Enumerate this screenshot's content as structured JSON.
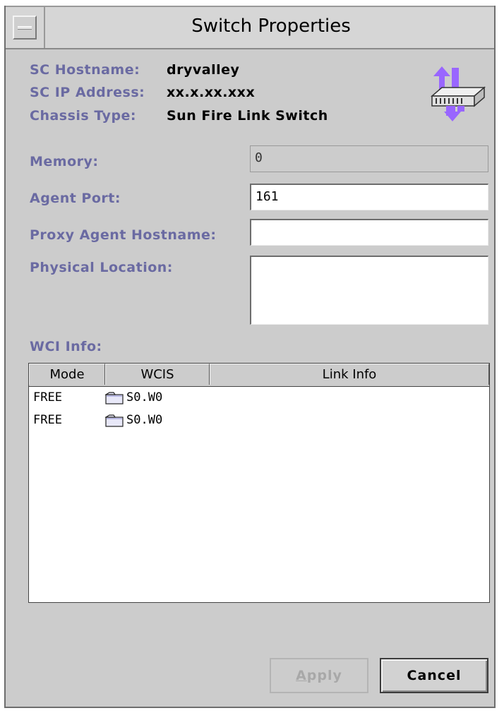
{
  "window": {
    "title": "Switch Properties"
  },
  "header": {
    "hostname_label": "SC Hostname:",
    "hostname_value": "dryvalley",
    "ip_label": "SC IP Address:",
    "ip_value": "xx.x.xx.xxx",
    "chassis_label": "Chassis Type:",
    "chassis_value": "Sun Fire Link Switch",
    "icon": "network-switch-icon"
  },
  "form": {
    "memory_label": "Memory:",
    "memory_value": "0",
    "agent_port_label": "Agent Port:",
    "agent_port_value": "161",
    "proxy_label": "Proxy Agent Hostname:",
    "proxy_value": "",
    "location_label": "Physical Location:",
    "location_value": ""
  },
  "wci": {
    "label": "WCI Info:",
    "columns": [
      "Mode",
      "WCIS",
      "Link Info"
    ],
    "rows": [
      {
        "mode": "FREE",
        "wcis": "S0.W0",
        "link": ""
      },
      {
        "mode": "FREE",
        "wcis": "S0.W0",
        "link": ""
      }
    ]
  },
  "buttons": {
    "apply_mnemonic": "A",
    "apply_rest": "pply",
    "cancel": "Cancel"
  },
  "colors": {
    "label": "#6a6aa2",
    "background": "#cccccc",
    "icon_arrows": "#9966ff"
  }
}
